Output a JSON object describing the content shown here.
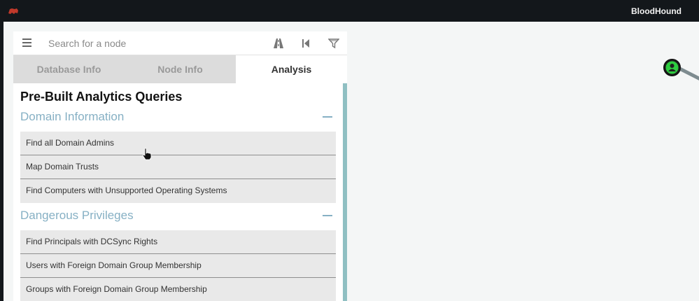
{
  "titlebar": {
    "app_title": "BloodHound",
    "logo_icon": "bloodhound-logo-icon"
  },
  "search": {
    "placeholder": "Search for a node"
  },
  "tabs": [
    {
      "label": "Database Info",
      "active": false
    },
    {
      "label": "Node Info",
      "active": false
    },
    {
      "label": "Analysis",
      "active": true
    }
  ],
  "analysis": {
    "heading": "Pre-Built Analytics Queries",
    "sections": [
      {
        "title": "Domain Information",
        "queries": [
          "Find all Domain Admins",
          "Map Domain Trusts",
          "Find Computers with Unsupported Operating Systems"
        ]
      },
      {
        "title": "Dangerous Privileges",
        "queries": [
          "Find Principals with DCSync Rights",
          "Users with Foreign Domain Group Membership",
          "Groups with Foreign Domain Group Membership"
        ]
      }
    ]
  },
  "colors": {
    "accent": "#86b0c4",
    "node_fill": "#2ecc40",
    "background": "#13171b"
  }
}
